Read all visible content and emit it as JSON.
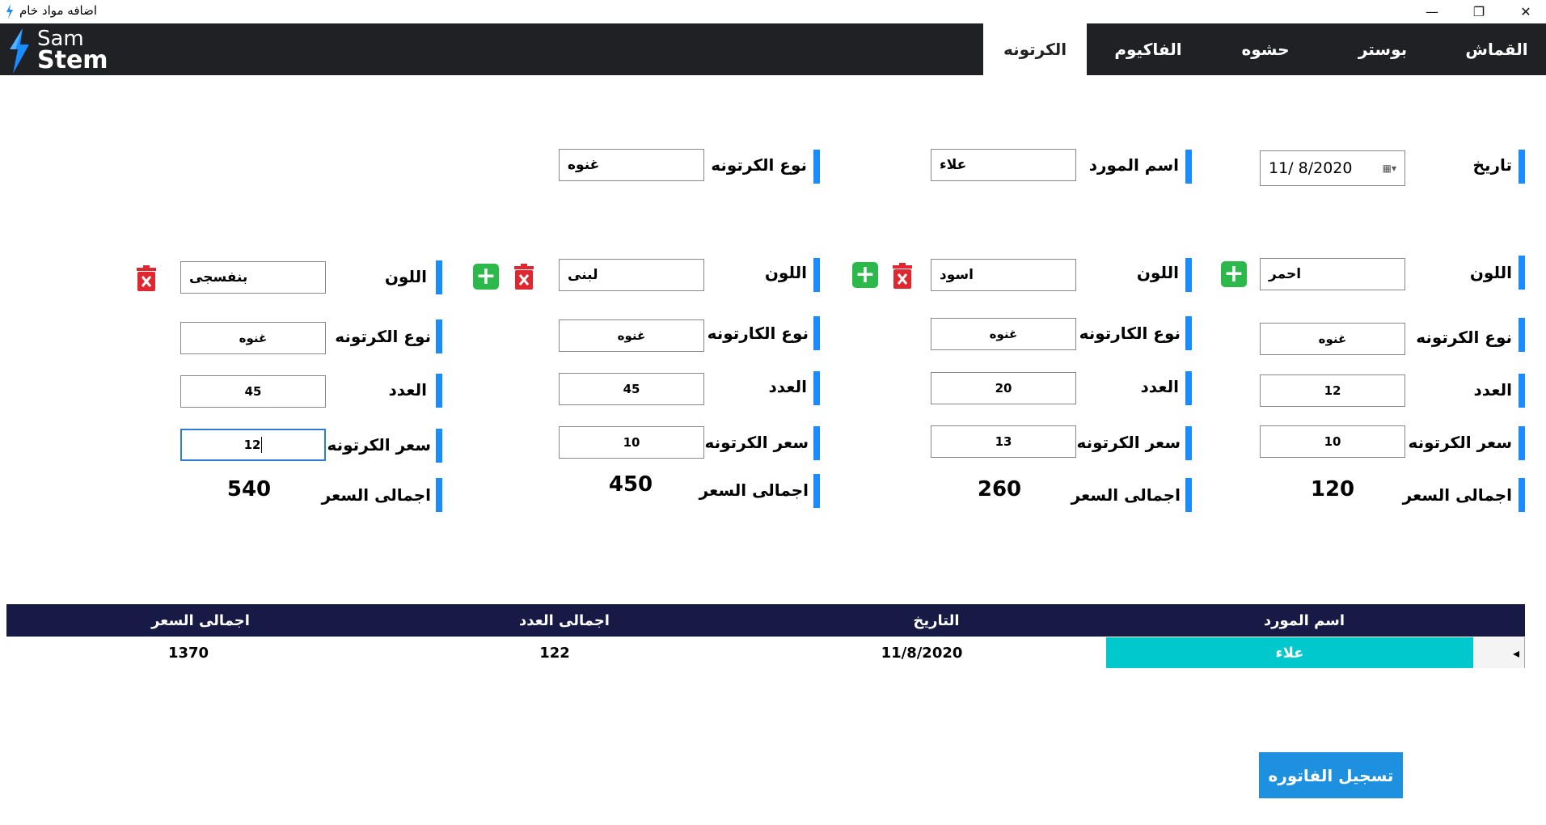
{
  "window": {
    "title": "اضافه مواد خام",
    "minimize": "—",
    "restore": "❐",
    "close": "✕"
  },
  "logo": {
    "line1": "Sam",
    "line2": "Stem"
  },
  "tabs": [
    "القماش",
    "بوستر",
    "حشوه",
    "الفاكيوم",
    "الكرتونه"
  ],
  "active_tab": "الكرتونه",
  "header_form": {
    "date_label": "تاريخ",
    "date_value": "11/  8/2020",
    "supplier_label": "اسم المورد",
    "supplier_value": "علاء",
    "carton_type_label": "نوع الكرتونه",
    "carton_type_value": "غنوه"
  },
  "items": [
    {
      "color_label": "اللون",
      "color": "احمر",
      "type_label": "نوع الكرتونه",
      "type": "غنوه",
      "count_label": "العدد",
      "count": "12",
      "price_label": "سعر الكرتونه",
      "price": "10",
      "total_label": "اجمالى السعر",
      "total": "120"
    },
    {
      "color_label": "اللون",
      "color": "اسود",
      "type_label": "نوع الكارتونه",
      "type": "غنوه",
      "count_label": "العدد",
      "count": "20",
      "price_label": "سعر الكرتونه",
      "price": "13",
      "total_label": "اجمالى السعر",
      "total": "260"
    },
    {
      "color_label": "اللون",
      "color": "لبنى",
      "type_label": "نوع الكارتونه",
      "type": "غنوه",
      "count_label": "العدد",
      "count": "45",
      "price_label": "سعر الكرتونه",
      "price": "10",
      "total_label": "اجمالى السعر",
      "total": "450"
    },
    {
      "color_label": "اللون",
      "color": "بنفسجى",
      "type_label": "نوع الكرتونه",
      "type": "غنوه",
      "count_label": "العدد",
      "count": "45",
      "price_label": "سعر الكرتونه",
      "price": "12",
      "total_label": "اجمالى السعر",
      "total": "540"
    }
  ],
  "grid": {
    "headers": [
      "اسم المورد",
      "التاريخ",
      "اجمالى العدد",
      "اجمالى السعر"
    ],
    "row": {
      "supplier": "علاء",
      "date": "11/8/2020",
      "total_count": "122",
      "total_price": "1370"
    },
    "row_indicator": "◂"
  },
  "submit_label": "تسجيل الفاتوره",
  "colors": {
    "accent": "#1a8cff",
    "header_bg": "#202124",
    "grid_head": "#171a45",
    "selected_cell": "#00c8cc",
    "add": "#2db84b",
    "delete": "#e0262e"
  }
}
